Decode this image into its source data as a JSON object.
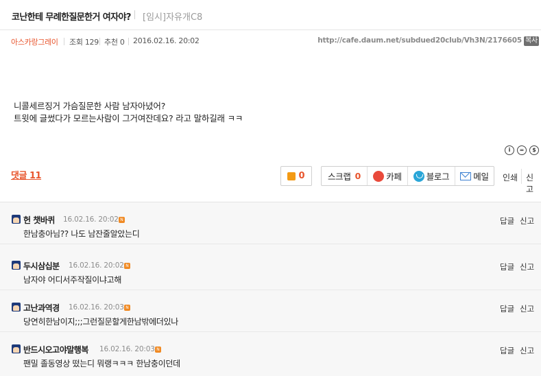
{
  "post": {
    "title": "코난한테 무례한질문한거 여자야?",
    "board": "[임시]자유개C8",
    "author": "아스카랑그레이",
    "views": "조회 129",
    "recommends": "추천 0",
    "date": "2016.02.16. 20:02",
    "url": "http://cafe.daum.net/subdued20club/Vh3N/2176605",
    "copy_label": "복사",
    "body_lines": [
      "니콜세르징거 가슴질문한 사람 남자아녔어?",
      "트윗에 글썼다가 모르는사람이 그거여잔데요? 라고 말하길래 ㅋㅋ"
    ]
  },
  "actions": {
    "comment_count": "댓글 11",
    "like_count": "0",
    "scrap_label": "스크랩",
    "scrap_count": "0",
    "cafe_label": "카페",
    "blog_label": "블로그",
    "mail_label": "메일",
    "print_label": "인쇄",
    "report_label": "신고"
  },
  "comments": [
    {
      "author": "헌 챗바퀴",
      "date": "16.02.16. 20:02",
      "text": "한남충아님?? 나도 남잔줄알았는디",
      "reply": "답글",
      "report": "신고"
    },
    {
      "author": "두시삼십분",
      "date": "16.02.16. 20:02",
      "text": "남자야 어디서주작질이냐고해",
      "reply": "답글",
      "report": "신고"
    },
    {
      "author": "고난과역경",
      "date": "16.02.16. 20:03",
      "text": "당연히한남이지;;;그런질문할게한남밖에더있나",
      "reply": "답글",
      "report": "신고"
    },
    {
      "author": "반드시오고야말행복",
      "date": "16.02.16. 20:03",
      "text": "팬밀 졸동영상 떴는디 뭐랭ㅋㅋㅋ 한남충이던데",
      "reply": "답글",
      "report": "신고"
    }
  ],
  "colors": {
    "accent": "#e8552d",
    "new_badge": "#f08a24"
  }
}
